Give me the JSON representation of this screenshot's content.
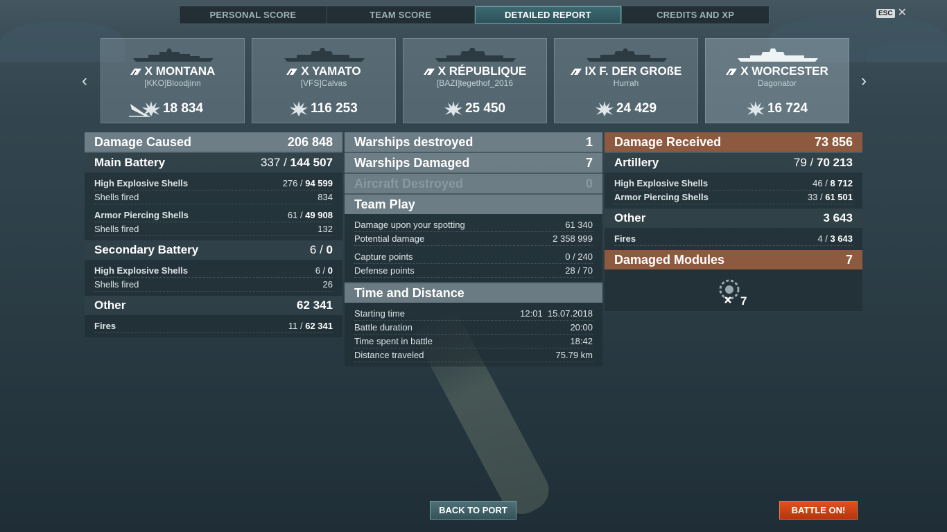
{
  "tabs": [
    {
      "label": "PERSONAL SCORE",
      "active": false
    },
    {
      "label": "TEAM SCORE",
      "active": false
    },
    {
      "label": "DETAILED REPORT",
      "active": true
    },
    {
      "label": "CREDITS AND XP",
      "active": false
    }
  ],
  "esc_label": "ESC",
  "close_glyph": "✕",
  "nav": {
    "prev_icon": "chevron-left-icon",
    "next_icon": "chevron-right-icon"
  },
  "cards": [
    {
      "ship": "X MONTANA",
      "player": "[KKO]Bloodjinn",
      "damage": "18 834",
      "destroyed": true
    },
    {
      "ship": "X YAMATO",
      "player": "[VFS]Calvas",
      "damage": "116 253",
      "destroyed": false
    },
    {
      "ship": "X RÉPUBLIQUE",
      "player": "[BAZI]tegethof_2016",
      "damage": "25 450",
      "destroyed": false
    },
    {
      "ship": "IX F. DER GROßE",
      "player": "Hurrah",
      "damage": "24 429",
      "destroyed": false
    },
    {
      "ship": "X WORCESTER",
      "player": "Dagonator",
      "damage": "16 724",
      "destroyed": false
    }
  ],
  "damage_caused": {
    "title": "Damage Caused",
    "value": "206 848",
    "main_battery": {
      "title": "Main Battery",
      "hits": "337",
      "value": "144 507",
      "he": {
        "label": "High Explosive Shells",
        "hits": "276",
        "value": "94 599",
        "fired_label": "Shells fired",
        "fired": "834"
      },
      "ap": {
        "label": "Armor Piercing Shells",
        "hits": "61",
        "value": "49 908",
        "fired_label": "Shells fired",
        "fired": "132"
      }
    },
    "secondary": {
      "title": "Secondary Battery",
      "hits": "6",
      "value": "0",
      "he": {
        "label": "High Explosive Shells",
        "hits": "6",
        "value": "0",
        "fired_label": "Shells fired",
        "fired": "26"
      }
    },
    "other": {
      "title": "Other",
      "value": "62 341",
      "fires": {
        "label": "Fires",
        "hits": "11",
        "value": "62 341"
      }
    }
  },
  "middle": {
    "warships_destroyed": {
      "label": "Warships destroyed",
      "value": "1"
    },
    "warships_damaged": {
      "label": "Warships Damaged",
      "value": "7"
    },
    "aircraft_destroyed": {
      "label": "Aircraft Destroyed",
      "value": "0"
    },
    "team_play": {
      "title": "Team Play",
      "spotting": {
        "label": "Damage upon your spotting",
        "value": "61 340"
      },
      "potential": {
        "label": "Potential damage",
        "value": "2 358 999"
      },
      "capture": {
        "label": "Capture points",
        "value": "0 / 240"
      },
      "defense": {
        "label": "Defense points",
        "value": "28 / 70"
      }
    },
    "time": {
      "title": "Time and Distance",
      "start": {
        "label": "Starting time",
        "value": "12:01  15.07.2018"
      },
      "duration": {
        "label": "Battle duration",
        "value": "20:00"
      },
      "spent": {
        "label": "Time spent in battle",
        "value": "18:42"
      },
      "distance": {
        "label": "Distance traveled",
        "value": "75.79 km"
      }
    }
  },
  "damage_received": {
    "title": "Damage Received",
    "value": "73 856",
    "artillery": {
      "title": "Artillery",
      "hits": "79",
      "value": "70 213",
      "he": {
        "label": "High Explosive Shells",
        "hits": "46",
        "value": "8 712"
      },
      "ap": {
        "label": "Armor Piercing Shells",
        "hits": "33",
        "value": "61 501"
      }
    },
    "other": {
      "title": "Other",
      "value": "3 643",
      "fires": {
        "label": "Fires",
        "hits": "4",
        "value": "3 643"
      }
    },
    "modules": {
      "title": "Damaged Modules",
      "value": "7",
      "icon": "damaged-module-icon",
      "count": "7"
    }
  },
  "buttons": {
    "back": "BACK TO PORT",
    "battle": "BATTLE ON!"
  },
  "colors": {
    "accent_red": "#8e5a3f",
    "battle_button": "#d2441a",
    "active_tab": "#2d5158"
  }
}
